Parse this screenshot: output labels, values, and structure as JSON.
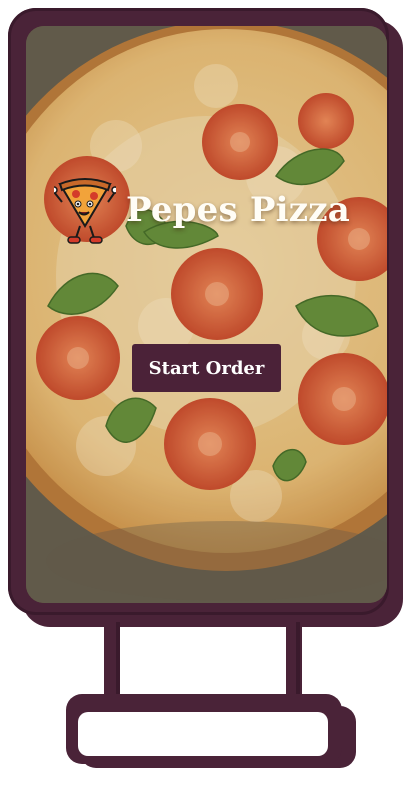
{
  "brand": {
    "name": "Pepes Pizza"
  },
  "actions": {
    "start_order_label": "Start Order"
  },
  "colors": {
    "primary": "#4b2238",
    "title_text": "#fffdf6",
    "button_text": "#ffffff"
  },
  "icons": {
    "mascot": "pizza-slice-mascot-icon"
  }
}
